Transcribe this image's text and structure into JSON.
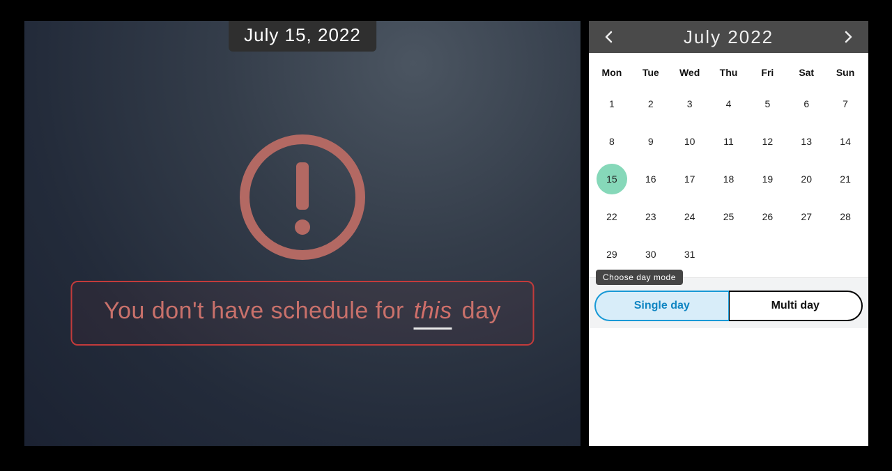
{
  "main": {
    "selected_date_label": "July 15, 2022",
    "empty_message_prefix": "You don't have schedule for ",
    "empty_message_emphasis": "this",
    "empty_message_suffix": " day"
  },
  "calendar": {
    "title": "July 2022",
    "days_of_week": [
      "Mon",
      "Tue",
      "Wed",
      "Thu",
      "Fri",
      "Sat",
      "Sun"
    ],
    "weeks": [
      [
        1,
        2,
        3,
        4,
        5,
        6,
        7
      ],
      [
        8,
        9,
        10,
        11,
        12,
        13,
        14
      ],
      [
        15,
        16,
        17,
        18,
        19,
        20,
        21
      ],
      [
        22,
        23,
        24,
        25,
        26,
        27,
        28
      ],
      [
        29,
        30,
        31,
        null,
        null,
        null,
        null
      ]
    ],
    "selected_day": 15
  },
  "mode": {
    "label": "Choose day mode",
    "options": [
      "Single day",
      "Multi day"
    ],
    "active_index": 0
  },
  "colors": {
    "accent_red": "#c9716b",
    "selected_green": "#86d8b9",
    "toggle_blue": "#1799d6"
  }
}
